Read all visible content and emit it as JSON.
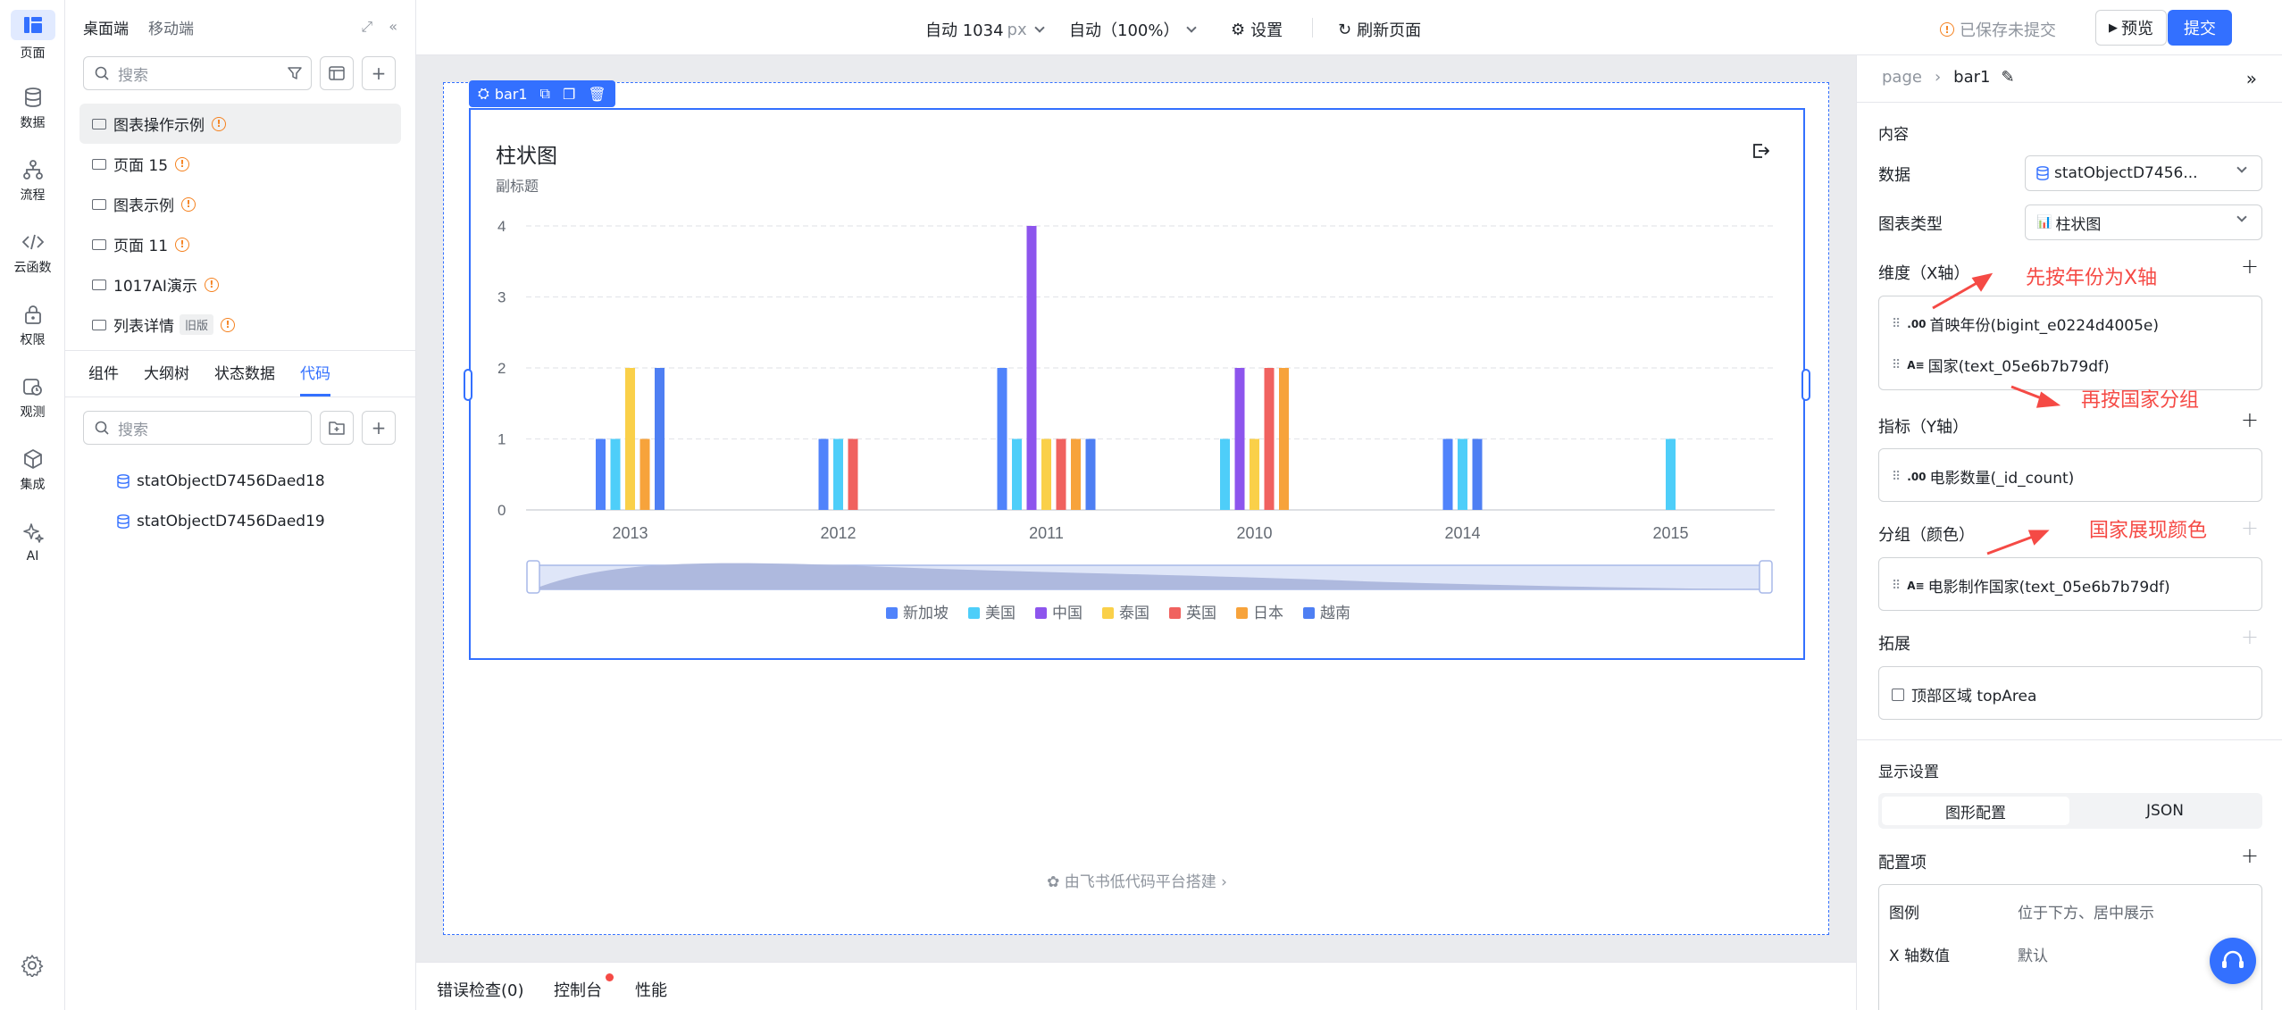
{
  "rail": {
    "items": [
      {
        "label": "页面",
        "icon": "layout-icon",
        "active": true
      },
      {
        "label": "数据",
        "icon": "database-icon"
      },
      {
        "label": "流程",
        "icon": "flow-icon"
      },
      {
        "label": "云函数",
        "icon": "code-icon"
      },
      {
        "label": "权限",
        "icon": "lock-icon"
      },
      {
        "label": "观测",
        "icon": "observe-icon"
      },
      {
        "label": "集成",
        "icon": "cube-icon"
      },
      {
        "label": "AI",
        "icon": "sparkle-icon"
      }
    ]
  },
  "leftpanel": {
    "tab_desktop": "桌面端",
    "tab_mobile": "移动端",
    "search_placeholder": "搜索",
    "pages": [
      {
        "label": "图表操作示例",
        "warn": true
      },
      {
        "label": "页面 15",
        "warn": true
      },
      {
        "label": "图表示例",
        "warn": true
      },
      {
        "label": "页面 11",
        "warn": true
      },
      {
        "label": "1017AI演示",
        "warn": true
      },
      {
        "label": "列表详情",
        "tag": "旧版",
        "warn": true
      }
    ],
    "tabs2": [
      "组件",
      "大纲树",
      "状态数据",
      "代码"
    ],
    "search2_placeholder": "搜索",
    "code_items": [
      "statObjectD7456Daed18",
      "statObjectD7456Daed19"
    ]
  },
  "topbar": {
    "width_label": "自动 1034",
    "width_unit": "px",
    "zoom_label": "自动（100%）",
    "settings": "设置",
    "refresh": "刷新页面",
    "status": "已保存未提交",
    "preview": "预览",
    "submit": "提交"
  },
  "canvas": {
    "selected_component": "bar1",
    "footer": "由飞书低代码平台搭建"
  },
  "chart_data": {
    "type": "bar",
    "title": "柱状图",
    "subtitle": "副标题",
    "categories": [
      "2013",
      "2012",
      "2011",
      "2010",
      "2014",
      "2015"
    ],
    "ylim": [
      0,
      4
    ],
    "yticks": [
      "0",
      "1",
      "2",
      "3",
      "4"
    ],
    "grid": true,
    "legend_position": "bottom-center",
    "series": [
      {
        "name": "新加坡",
        "color": "#5083fb",
        "values": [
          1,
          1,
          2,
          0,
          1,
          0
        ]
      },
      {
        "name": "美国",
        "color": "#4ecef9",
        "values": [
          1,
          1,
          1,
          1,
          1,
          1
        ]
      },
      {
        "name": "中国",
        "color": "#8d55ed",
        "values": [
          0,
          0,
          4,
          2,
          0,
          0
        ]
      },
      {
        "name": "泰国",
        "color": "#fad049",
        "values": [
          2,
          0,
          1,
          1,
          0,
          0
        ]
      },
      {
        "name": "英国",
        "color": "#f0625f",
        "values": [
          0,
          1,
          1,
          2,
          0,
          0
        ]
      },
      {
        "name": "日本",
        "color": "#f7a33b",
        "values": [
          1,
          0,
          1,
          2,
          0,
          0
        ]
      },
      {
        "name": "越南",
        "color": "#4e7ff3",
        "values": [
          2,
          0,
          1,
          0,
          1,
          0
        ]
      }
    ]
  },
  "bottombar": {
    "errors": "错误检查(0)",
    "console": "控制台",
    "perf": "性能"
  },
  "rightpanel": {
    "crumb_root": "page",
    "crumb_current": "bar1",
    "section_content": "内容",
    "data_label": "数据",
    "data_value": "statObjectD7456...",
    "charttype_label": "图表类型",
    "charttype_value": "柱状图",
    "dim_label": "维度（X轴）",
    "dim_items": [
      {
        "type": ".00",
        "text": "首映年份(bigint_e0224d4005e)"
      },
      {
        "type": "A≡",
        "text": "国家(text_05e6b7b79df)"
      }
    ],
    "metric_label": "指标（Y轴）",
    "metric_items": [
      {
        "type": ".00",
        "text": "电影数量(_id_count)"
      }
    ],
    "group_label": "分组（颜色）",
    "group_items": [
      {
        "type": "A≡",
        "text": "电影制作国家(text_05e6b7b79df)"
      }
    ],
    "ext_label": "拓展",
    "ext_items": [
      {
        "text": "顶部区域 topArea"
      }
    ],
    "display_label": "显示设置",
    "seg_a": "图形配置",
    "seg_b": "JSON",
    "config_label": "配置项",
    "config_rows": [
      {
        "key": "图例",
        "value": "位于下方、居中展示"
      },
      {
        "key": "X 轴数值",
        "value": "默认"
      }
    ]
  },
  "annotations": {
    "a1": "先按年份为X轴",
    "a2": "再按国家分组",
    "a3": "国家展现颜色"
  }
}
